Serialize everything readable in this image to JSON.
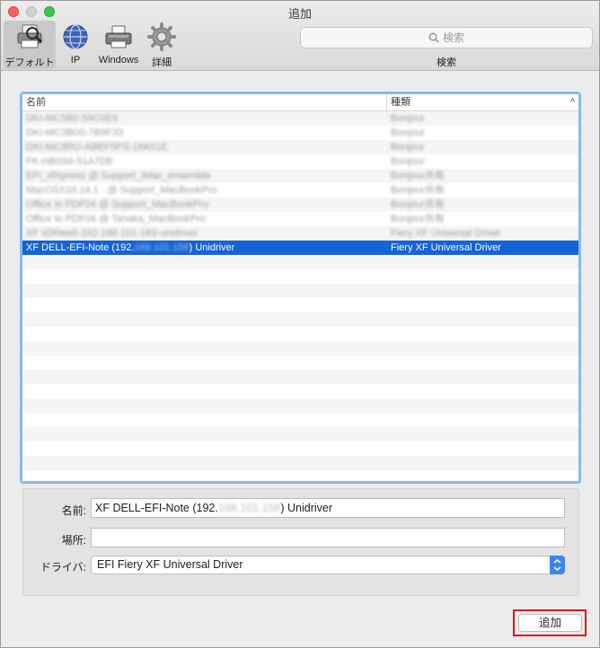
{
  "window": {
    "title": "追加"
  },
  "toolbar": {
    "items": [
      {
        "label": "デフォルト",
        "icon": "default-printer-icon",
        "selected": true
      },
      {
        "label": "IP",
        "icon": "ip-globe-icon",
        "selected": false
      },
      {
        "label": "Windows",
        "icon": "windows-printer-icon",
        "selected": false
      },
      {
        "label": "詳細",
        "icon": "advanced-gear-icon",
        "selected": false
      }
    ],
    "search": {
      "placeholder": "検索",
      "caption": "検索"
    }
  },
  "printer_list": {
    "columns": {
      "name": "名前",
      "kind": "種類"
    },
    "rows": [
      {
        "name": "DKI-MC5B0-59C0E9",
        "kind": "Bonjour",
        "obscured": true
      },
      {
        "name": "DKI-MC3B0S-7B6F33",
        "kind": "Bonjour",
        "obscured": true
      },
      {
        "name": "DKI-MC8RO-ABEF5PS-18A51E",
        "kind": "Bonjour",
        "obscured": true
      },
      {
        "name": "FK-HB0S6-51A7DE",
        "kind": "Bonjour",
        "obscured": true
      },
      {
        "name": "EFI_xfXpress @ Support_IMac_ensemble",
        "kind": "Bonjour共有",
        "obscured": true
      },
      {
        "name": "MacOSX10.14.1 - @ Support_MacBookPro",
        "kind": "Bonjour共有",
        "obscured": true
      },
      {
        "name": "Office to PDF04 @ Support_MacBookPro",
        "kind": "Bonjour共有",
        "obscured": true
      },
      {
        "name": "Office to PDF04 @ Tanaka_MacBookPro",
        "kind": "Bonjour共有",
        "obscured": true
      },
      {
        "name": "XF sDl0ee6-192-168-101-183-unidriver",
        "kind": "Fiery XF Universal Driver",
        "obscured": true
      },
      {
        "name_prefix": "XF DELL-EFI-Note (192.",
        "name_hidden": "168.101.158",
        "name_suffix": ") Unidriver",
        "kind": "Fiery XF Universal Driver",
        "selected": true
      }
    ],
    "empty_row_count": 16,
    "sort_indicator": "^"
  },
  "details": {
    "name": {
      "label": "名前:",
      "value_prefix": "XF DELL-EFI-Note (192.",
      "value_hidden": "168.101.158",
      "value_suffix": ") Unidriver"
    },
    "location": {
      "label": "場所:",
      "value": ""
    },
    "driver": {
      "label": "ドライバ:",
      "value": "EFI Fiery XF Universal Driver"
    }
  },
  "actions": {
    "add_label": "追加"
  },
  "colors": {
    "selection": "#1663d6",
    "list_focus_ring": "#8ab8f0",
    "highlight_box": "#e0151b",
    "select_accent": "#3d86f0"
  }
}
